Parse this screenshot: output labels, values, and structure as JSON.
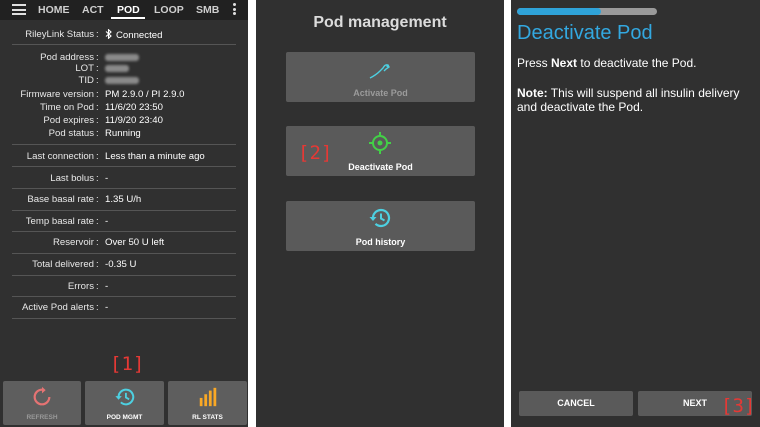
{
  "panel1": {
    "tabs": [
      "HOME",
      "ACT",
      "POD",
      "LOOP",
      "SMB"
    ],
    "active_tab": "POD",
    "rows": [
      {
        "label": "RileyLink Status",
        "value": "Connected",
        "icon": "bluetooth-icon"
      },
      {
        "label": "Pod address",
        "value": "",
        "redacted": true
      },
      {
        "label": "LOT",
        "value": "",
        "redacted": true
      },
      {
        "label": "TID",
        "value": "",
        "redacted": true
      },
      {
        "label": "Firmware version",
        "value": "PM 2.9.0 / PI 2.9.0"
      },
      {
        "label": "Time on Pod",
        "value": "11/6/20 23:50"
      },
      {
        "label": "Pod expires",
        "value": "11/9/20 23:40"
      },
      {
        "label": "Pod status",
        "value": "Running"
      },
      {
        "label": "Last connection",
        "value": "Less than a minute ago"
      },
      {
        "label": "Last bolus",
        "value": "-"
      },
      {
        "label": "Base basal rate",
        "value": "1.35 U/h"
      },
      {
        "label": "Temp basal rate",
        "value": "-"
      },
      {
        "label": "Reservoir",
        "value": "Over 50 U left"
      },
      {
        "label": "Total delivered",
        "value": "-0.35 U"
      },
      {
        "label": "Errors",
        "value": "-"
      },
      {
        "label": "Active Pod alerts",
        "value": "-"
      }
    ],
    "separator": ":",
    "buttons": {
      "refresh": "REFRESH",
      "pod_mgmt": "POD MGMT",
      "rl_stats": "RL STATS"
    },
    "annotation": "[1]",
    "colors": {
      "refresh_icon": "#e57373",
      "pod_mgmt_icon": "#4dd0e1",
      "rl_stats_icon": "#f9a825"
    }
  },
  "panel2": {
    "title": "Pod management",
    "buttons": {
      "activate": "Activate Pod",
      "deactivate": "Deactivate Pod",
      "history": "Pod history"
    },
    "annotation": "[2]",
    "colors": {
      "deactivate_icon": "#43d047",
      "icons": "#4dd0e1"
    }
  },
  "panel3": {
    "progress": 0.6,
    "title": "Deactivate Pod",
    "instruction_pre": "Press ",
    "instruction_bold": "Next",
    "instruction_post": " to deactivate the Pod.",
    "note_bold": "Note:",
    "note_text": " This will suspend all insulin delivery and deactivate the Pod.",
    "cancel_label": "CANCEL",
    "next_label": "NEXT",
    "annotation": "[3]",
    "colors": {
      "accent": "#33a8e0",
      "annotation": "#e53935"
    }
  }
}
